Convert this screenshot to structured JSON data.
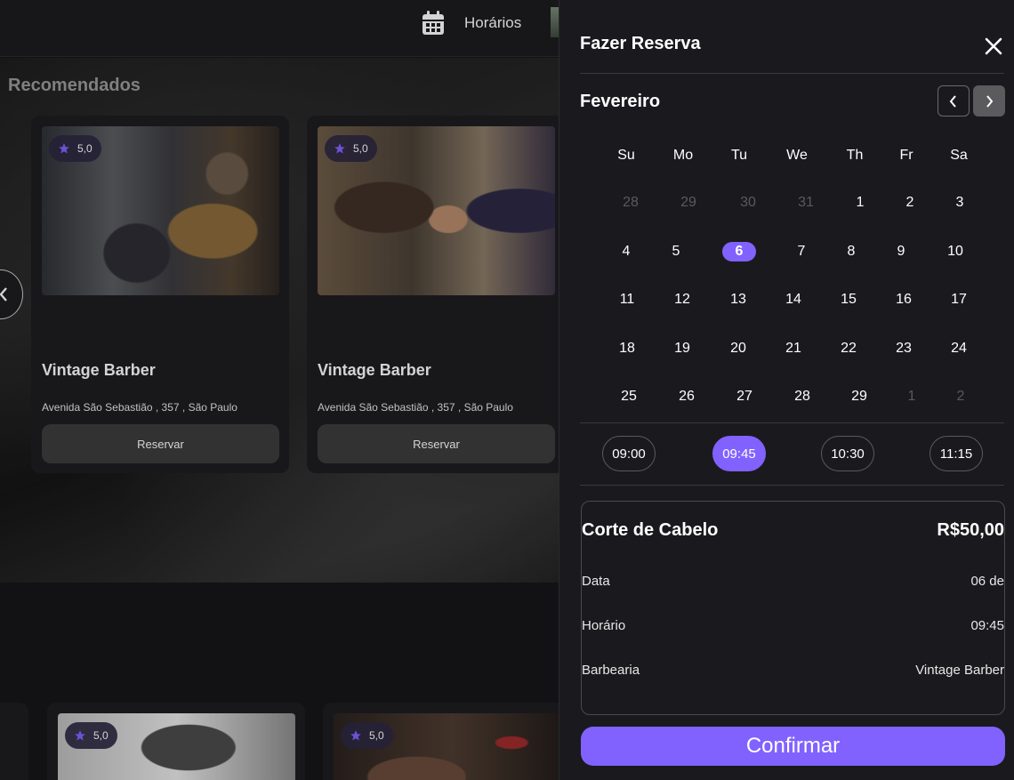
{
  "header": {
    "schedule_label": "Horários",
    "calendar_icon": "calendar-icon"
  },
  "recommended": {
    "title": "Recomendados",
    "cards": [
      {
        "rating": "5,0",
        "name": "Vintage Barber",
        "address": "Avenida São Sebastião , 357 , São Paulo",
        "button": "Reservar"
      },
      {
        "rating": "5,0",
        "name": "Vintage Barber",
        "address": "Avenida São Sebastião , 357 , São Paulo",
        "button": "Reservar"
      }
    ]
  },
  "bottom_cards": [
    {
      "rating": "5,0"
    },
    {
      "rating": "5,0"
    }
  ],
  "booking": {
    "title": "Fazer Reserva",
    "month": "Fevereiro",
    "weekdays": [
      "Su",
      "Mo",
      "Tu",
      "We",
      "Th",
      "Fr",
      "Sa"
    ],
    "days": [
      [
        "28",
        "29",
        "30",
        "31",
        "1",
        "2",
        "3"
      ],
      [
        "4",
        "5",
        "6",
        "7",
        "8",
        "9",
        "10"
      ],
      [
        "11",
        "12",
        "13",
        "14",
        "15",
        "16",
        "17"
      ],
      [
        "18",
        "19",
        "20",
        "21",
        "22",
        "23",
        "24"
      ],
      [
        "25",
        "26",
        "27",
        "28",
        "29",
        "1",
        "2"
      ]
    ],
    "selected_day": "6",
    "times": [
      "09:00",
      "09:45",
      "10:30",
      "11:15"
    ],
    "selected_time": "09:45",
    "summary": {
      "service": "Corte de Cabelo",
      "price": "R$50,00",
      "date_label": "Data",
      "date_value": "06 de",
      "time_label": "Horário",
      "time_value": "09:45",
      "shop_label": "Barbearia",
      "shop_value": "Vintage Barber"
    },
    "confirm_label": "Confirmar"
  },
  "colors": {
    "accent": "#8162ff",
    "background": "#141418",
    "panel": "#1a1a1e",
    "card": "#1b1b1f",
    "button": "#3b3b3b"
  }
}
